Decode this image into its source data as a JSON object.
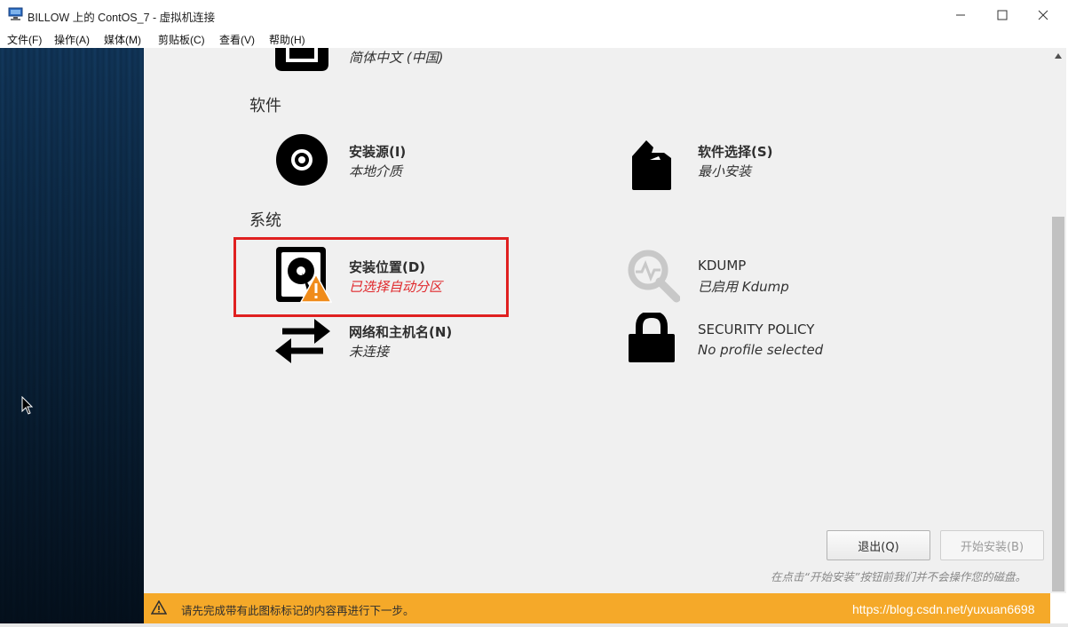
{
  "window": {
    "title": "BILLOW 上的 ContOS_7 - 虚拟机连接",
    "minimize_icon": "minimize-icon",
    "maximize_icon": "maximize-icon",
    "close_icon": "close-icon"
  },
  "menu": {
    "items": [
      "文件(F)",
      "操作(A)",
      "媒体(M)",
      "剪贴板(C)",
      "查看(V)",
      "帮助(H)"
    ]
  },
  "localization": {
    "language_status": "简体中文 (中国)"
  },
  "sections": {
    "software": "软件",
    "system": "系统"
  },
  "spokes": {
    "install_source": {
      "label": "安装源(I)",
      "status": "本地介质",
      "icon": "disc-icon"
    },
    "software_selection": {
      "label": "软件选择(S)",
      "status": "最小安装",
      "icon": "package-icon"
    },
    "install_destination": {
      "label": "安装位置(D)",
      "status": "已选择自动分区",
      "icon": "harddisk-warning-icon"
    },
    "kdump": {
      "label": "KDUMP",
      "status": "已启用 Kdump",
      "icon": "search-pulse-icon"
    },
    "network": {
      "label": "网络和主机名(N)",
      "status": "未连接",
      "icon": "network-arrows-icon"
    },
    "security_policy": {
      "label": "SECURITY POLICY",
      "status": "No profile selected",
      "icon": "lock-icon"
    }
  },
  "buttons": {
    "quit": "退出(Q)",
    "begin_install": "开始安装(B)"
  },
  "note": "在点击“开始安装”按钮前我们并不会操作您的磁盘。",
  "warning_bar": {
    "text": "请先完成带有此图标标记的内容再进行下一步。",
    "color": "#f5a929"
  },
  "watermark": "https://blog.csdn.net/yuxuan6698",
  "colors": {
    "highlight": "#e02020",
    "warning_status": "#e0292d",
    "hub_background": "#f0f0f0"
  }
}
